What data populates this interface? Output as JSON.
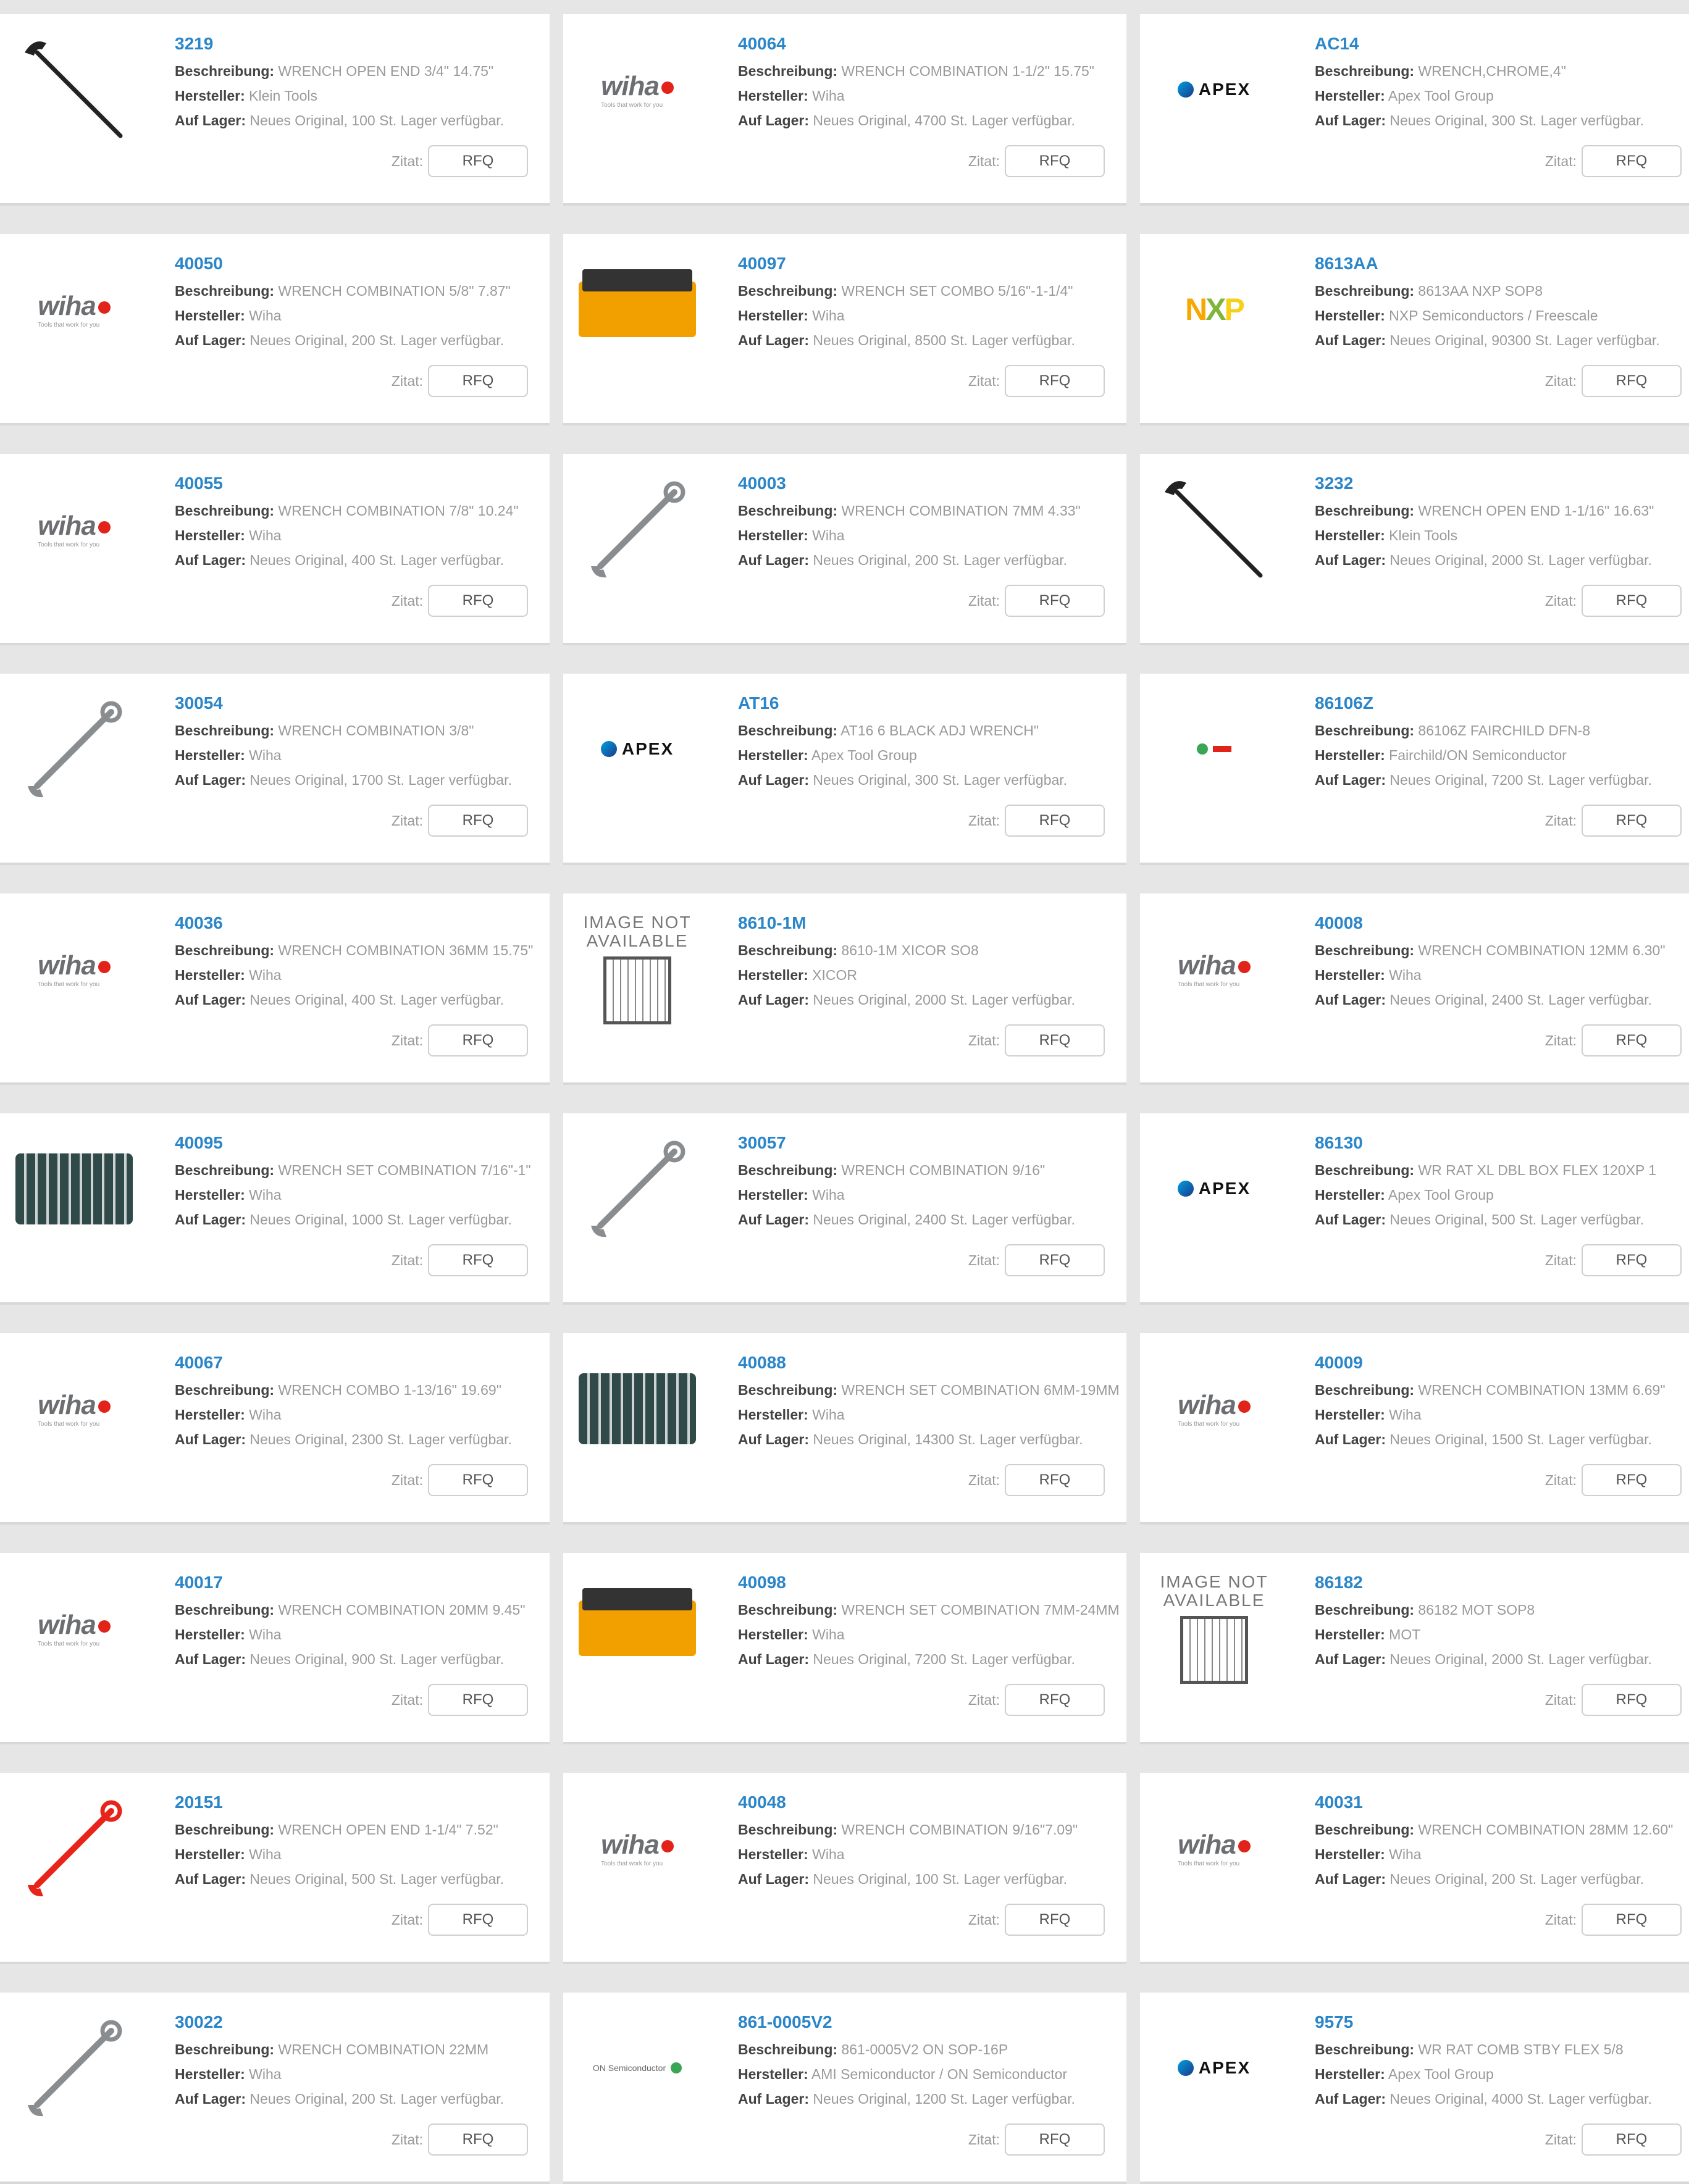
{
  "labels": {
    "desc": "Beschreibung:",
    "maker": "Hersteller:",
    "stock": "Auf Lager:",
    "quote": "Zitat:",
    "rfq": "RFQ"
  },
  "products": [
    {
      "pn": "3219",
      "desc": "WRENCH OPEN END 3/4\" 14.75\"",
      "maker": "Klein Tools",
      "stock": "Neues Original, 100 St. Lager verfügbar.",
      "logo": "wrench-open-end"
    },
    {
      "pn": "40064",
      "desc": "WRENCH COMBINATION 1-1/2\" 15.75\"",
      "maker": "Wiha",
      "stock": "Neues Original, 4700 St. Lager verfügbar.",
      "logo": "wiha"
    },
    {
      "pn": "AC14",
      "desc": "WRENCH,CHROME,4\"",
      "maker": "Apex Tool Group",
      "stock": "Neues Original, 300 St. Lager verfügbar.",
      "logo": "apex"
    },
    {
      "pn": "40050",
      "desc": "WRENCH COMBINATION 5/8\" 7.87\"",
      "maker": "Wiha",
      "stock": "Neues Original, 200 St. Lager verfügbar.",
      "logo": "wiha"
    },
    {
      "pn": "40097",
      "desc": "WRENCH SET COMBO 5/16\"-1-1/4\"",
      "maker": "Wiha",
      "stock": "Neues Original, 8500 St. Lager verfügbar.",
      "logo": "box"
    },
    {
      "pn": "8613AA",
      "desc": "8613AA NXP SOP8",
      "maker": "NXP Semiconductors / Freescale",
      "stock": "Neues Original, 90300 St. Lager verfügbar.",
      "logo": "nxp"
    },
    {
      "pn": "40055",
      "desc": "WRENCH COMBINATION 7/8\" 10.24\"",
      "maker": "Wiha",
      "stock": "Neues Original, 400 St. Lager verfügbar.",
      "logo": "wiha"
    },
    {
      "pn": "40003",
      "desc": "WRENCH COMBINATION 7MM 4.33\"",
      "maker": "Wiha",
      "stock": "Neues Original, 200 St. Lager verfügbar.",
      "logo": "wrench-combo"
    },
    {
      "pn": "3232",
      "desc": "WRENCH OPEN END 1-1/16\" 16.63\"",
      "maker": "Klein Tools",
      "stock": "Neues Original, 2000 St. Lager verfügbar.",
      "logo": "wrench-open-end"
    },
    {
      "pn": "30054",
      "desc": "WRENCH COMBINATION 3/8\"",
      "maker": "Wiha",
      "stock": "Neues Original, 1700 St. Lager verfügbar.",
      "logo": "wrench-combo"
    },
    {
      "pn": "AT16",
      "desc": "AT16 6 BLACK ADJ WRENCH\"",
      "maker": "Apex Tool Group",
      "stock": "Neues Original, 300 St. Lager verfügbar.",
      "logo": "apex"
    },
    {
      "pn": "86106Z",
      "desc": "86106Z FAIRCHILD DFN-8",
      "maker": "Fairchild/ON Semiconductor",
      "stock": "Neues Original, 7200 St. Lager verfügbar.",
      "logo": "fairchild"
    },
    {
      "pn": "40036",
      "desc": "WRENCH COMBINATION 36MM 15.75\"",
      "maker": "Wiha",
      "stock": "Neues Original, 400 St. Lager verfügbar.",
      "logo": "wiha"
    },
    {
      "pn": "8610-1M",
      "desc": "8610-1M XICOR SO8",
      "maker": "XICOR",
      "stock": "Neues Original, 2000 St. Lager verfügbar.",
      "logo": "image-not-available"
    },
    {
      "pn": "40008",
      "desc": "WRENCH COMBINATION 12MM 6.30\"",
      "maker": "Wiha",
      "stock": "Neues Original, 2400 St. Lager verfügbar.",
      "logo": "wiha"
    },
    {
      "pn": "40095",
      "desc": "WRENCH SET COMBINATION 7/16\"-1\"",
      "maker": "Wiha",
      "stock": "Neues Original, 1000 St. Lager verfügbar.",
      "logo": "pouch"
    },
    {
      "pn": "30057",
      "desc": "WRENCH COMBINATION 9/16\"",
      "maker": "Wiha",
      "stock": "Neues Original, 2400 St. Lager verfügbar.",
      "logo": "wrench-combo"
    },
    {
      "pn": "86130",
      "desc": "WR RAT XL DBL BOX FLEX 120XP 1",
      "maker": "Apex Tool Group",
      "stock": "Neues Original, 500 St. Lager verfügbar.",
      "logo": "apex"
    },
    {
      "pn": "40067",
      "desc": "WRENCH COMBO 1-13/16\" 19.69\"",
      "maker": "Wiha",
      "stock": "Neues Original, 2300 St. Lager verfügbar.",
      "logo": "wiha"
    },
    {
      "pn": "40088",
      "desc": "WRENCH SET COMBINATION 6MM-19MM",
      "maker": "Wiha",
      "stock": "Neues Original, 14300 St. Lager verfügbar.",
      "logo": "pouch"
    },
    {
      "pn": "40009",
      "desc": "WRENCH COMBINATION 13MM 6.69\"",
      "maker": "Wiha",
      "stock": "Neues Original, 1500 St. Lager verfügbar.",
      "logo": "wiha"
    },
    {
      "pn": "40017",
      "desc": "WRENCH COMBINATION 20MM 9.45\"",
      "maker": "Wiha",
      "stock": "Neues Original, 900 St. Lager verfügbar.",
      "logo": "wiha"
    },
    {
      "pn": "40098",
      "desc": "WRENCH SET COMBINATION 7MM-24MM",
      "maker": "Wiha",
      "stock": "Neues Original, 7200 St. Lager verfügbar.",
      "logo": "box"
    },
    {
      "pn": "86182",
      "desc": "86182 MOT SOP8",
      "maker": "MOT",
      "stock": "Neues Original, 2000 St. Lager verfügbar.",
      "logo": "image-not-available"
    },
    {
      "pn": "20151",
      "desc": "WRENCH OPEN END 1-1/4\" 7.52\"",
      "maker": "Wiha",
      "stock": "Neues Original, 500 St. Lager verfügbar.",
      "logo": "wrench-red"
    },
    {
      "pn": "40048",
      "desc": "WRENCH COMBINATION 9/16\"7.09\"",
      "maker": "Wiha",
      "stock": "Neues Original, 100 St. Lager verfügbar.",
      "logo": "wiha"
    },
    {
      "pn": "40031",
      "desc": "WRENCH COMBINATION 28MM 12.60\"",
      "maker": "Wiha",
      "stock": "Neues Original, 200 St. Lager verfügbar.",
      "logo": "wiha"
    },
    {
      "pn": "30022",
      "desc": "WRENCH COMBINATION 22MM",
      "maker": "Wiha",
      "stock": "Neues Original, 200 St. Lager verfügbar.",
      "logo": "wrench-combo"
    },
    {
      "pn": "861-0005V2",
      "desc": "861-0005V2 ON SOP-16P",
      "maker": "AMI Semiconductor / ON Semiconductor",
      "stock": "Neues Original, 1200 St. Lager verfügbar.",
      "logo": "on-semi"
    },
    {
      "pn": "9575",
      "desc": "WR RAT COMB STBY FLEX 5/8",
      "maker": "Apex Tool Group",
      "stock": "Neues Original, 4000 St. Lager verfügbar.",
      "logo": "apex"
    }
  ],
  "logo_text": {
    "wiha": "wiha",
    "wiha_tag": "Tools that work for you",
    "apex": "APEX",
    "nxp": [
      "N",
      "X",
      "P"
    ],
    "image_not_available": [
      "IMAGE NOT",
      "AVAILABLE"
    ],
    "on_semi": "ON Semiconductor"
  }
}
